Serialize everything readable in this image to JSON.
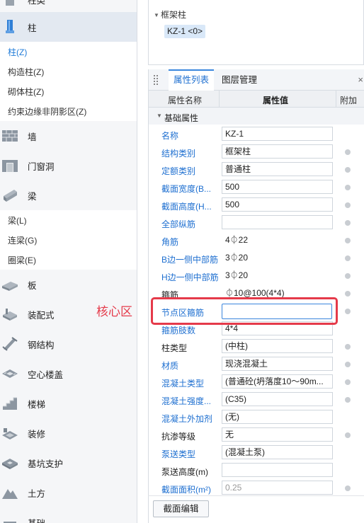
{
  "sidebar": {
    "cut_top_label": "柱类",
    "column_label": "柱",
    "column_subitems": [
      "柱(Z)",
      "构造柱(Z)",
      "砌体柱(Z)",
      "约束边缘非阴影区(Z)"
    ],
    "wall_label": "墙",
    "door_label": "门窗洞",
    "beam_label": "梁",
    "beam_subitems": [
      "梁(L)",
      "连梁(G)",
      "圈梁(E)"
    ],
    "slab_label": "板",
    "prefab_label": "装配式",
    "steel_label": "钢结构",
    "hollow_label": "空心楼盖",
    "stair_label": "楼梯",
    "deco_label": "装修",
    "pit_label": "基坑支护",
    "earth_label": "土方",
    "cut_bottom_label": "基础"
  },
  "tree": {
    "node_label": "框架柱",
    "chip_label": "KZ-1 <0>"
  },
  "panel": {
    "tab_props": "属性列表",
    "tab_layers": "图层管理",
    "close_glyph": "×",
    "col_name": "属性名称",
    "col_value": "属性值",
    "col_extra": "附加",
    "group_label": "基础属性",
    "rows": [
      {
        "name": "名称",
        "value": "KZ-1"
      },
      {
        "name": "结构类别",
        "value": "框架柱"
      },
      {
        "name": "定额类别",
        "value": "普通柱"
      },
      {
        "name": "截面宽度(B...",
        "value": "500"
      },
      {
        "name": "截面高度(H...",
        "value": "500"
      },
      {
        "name": "全部纵筋",
        "value": ""
      },
      {
        "name": "角筋",
        "value": "4⏀22"
      },
      {
        "name": "B边一侧中部筋",
        "value": "3⏀20"
      },
      {
        "name": "H边一侧中部筋",
        "value": "3⏀20"
      },
      {
        "name": "箍筋",
        "value": "⏀10@100(4*4)"
      },
      {
        "name": "节点区箍筋",
        "value": ""
      },
      {
        "name": "箍筋肢数",
        "value": "4*4"
      },
      {
        "name": "柱类型",
        "value": "(中柱)"
      },
      {
        "name": "材质",
        "value": "现浇混凝土"
      },
      {
        "name": "混凝土类型",
        "value": "(普通砼(坍落度10～90m..."
      },
      {
        "name": "混凝土强度...",
        "value": "(C35)"
      },
      {
        "name": "混凝土外加剂",
        "value": "(无)"
      },
      {
        "name": "抗渗等级",
        "value": "无"
      },
      {
        "name": "泵送类型",
        "value": "(混凝土泵)"
      },
      {
        "name": "泵送高度(m)",
        "value": ""
      },
      {
        "name": "截面面积(m²)",
        "value": "0.25"
      }
    ],
    "edit_button": "截面编辑"
  },
  "annotation": {
    "label": "核心区",
    "color": "#e53a4a"
  },
  "colors": {
    "accent": "#1e6fd0",
    "selected_bg": "#e3e9f1",
    "chip_bg": "#d9e8f8"
  }
}
